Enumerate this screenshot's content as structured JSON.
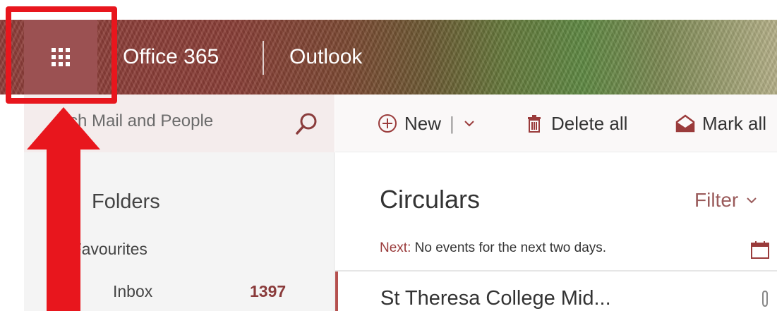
{
  "header": {
    "app_launcher_icon": "waffle-grid-icon",
    "brand": "Office 365",
    "app_name": "Outlook"
  },
  "search": {
    "placeholder": "rch Mail and People",
    "icon": "search-icon"
  },
  "toolbar": {
    "new_label": "New",
    "delete_all_label": "Delete all",
    "mark_all_label": "Mark all"
  },
  "navigation": {
    "folders_heading": "Folders",
    "favourites_label": "Favourites",
    "items": [
      {
        "label": "Inbox",
        "count": "1397"
      }
    ]
  },
  "message_list": {
    "folder_title": "Circulars",
    "filter_label": "Filter",
    "next_label": "Next:",
    "next_text": "No events for the next two days.",
    "messages": [
      {
        "sender": "St Theresa College Mid..."
      }
    ]
  },
  "colors": {
    "annotation_red": "#e8161d",
    "accent": "#9b5152",
    "count_color": "#8a3b3b"
  }
}
